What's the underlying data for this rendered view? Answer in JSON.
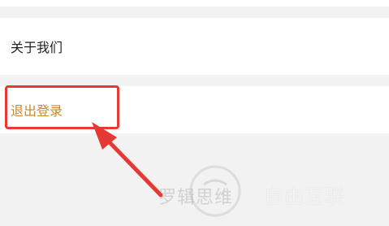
{
  "menu": {
    "about_us": "关于我们",
    "logout": "退出登录"
  },
  "watermark": {
    "brand_left": "罗辑思维",
    "brand_right": "自由互联"
  },
  "colors": {
    "background": "#f2f2f2",
    "row_background": "#ffffff",
    "logout_text": "#c98828",
    "highlight": "#e53935"
  },
  "icons": {
    "annotation": "arrow-pointer-icon"
  }
}
